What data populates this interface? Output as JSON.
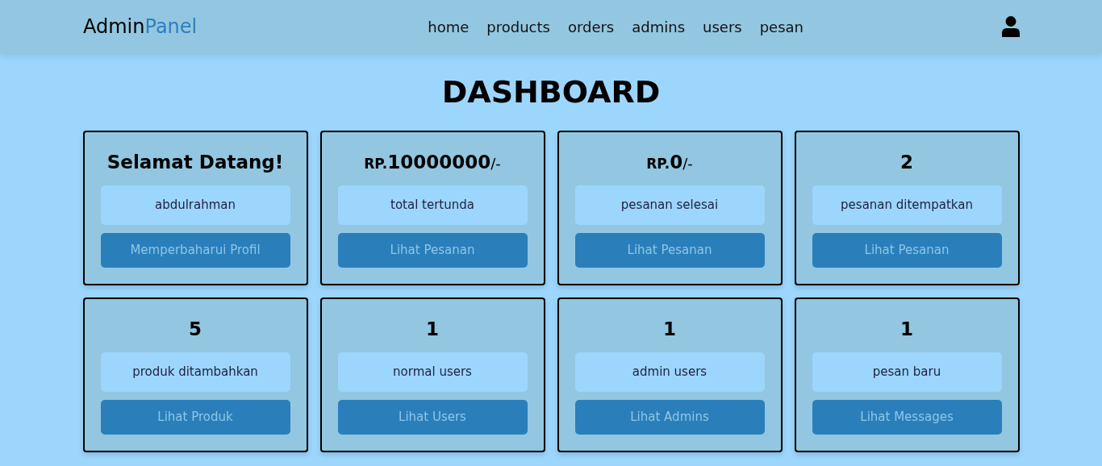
{
  "header": {
    "logo": {
      "first": "Admin",
      "second": "Panel"
    },
    "nav": [
      "home",
      "products",
      "orders",
      "admins",
      "users",
      "pesan"
    ]
  },
  "title": "DASHBOARD",
  "cards": [
    {
      "heading": {
        "value": "Selamat Datang!"
      },
      "label": "abdulrahman",
      "button": "Memperbaharui Profil"
    },
    {
      "heading": {
        "prefix": "RP.",
        "value": "10000000",
        "suffix": "/-"
      },
      "label": "total tertunda",
      "button": "Lihat Pesanan"
    },
    {
      "heading": {
        "prefix": "RP.",
        "value": "0",
        "suffix": "/-"
      },
      "label": "pesanan selesai",
      "button": "Lihat Pesanan"
    },
    {
      "heading": {
        "value": "2"
      },
      "label": "pesanan ditempatkan",
      "button": "Lihat Pesanan"
    },
    {
      "heading": {
        "value": "5"
      },
      "label": "produk ditambahkan",
      "button": "Lihat Produk"
    },
    {
      "heading": {
        "value": "1"
      },
      "label": "normal users",
      "button": "Lihat Users"
    },
    {
      "heading": {
        "value": "1"
      },
      "label": "admin users",
      "button": "Lihat Admins"
    },
    {
      "heading": {
        "value": "1"
      },
      "label": "pesan baru",
      "button": "Lihat Messages"
    }
  ]
}
